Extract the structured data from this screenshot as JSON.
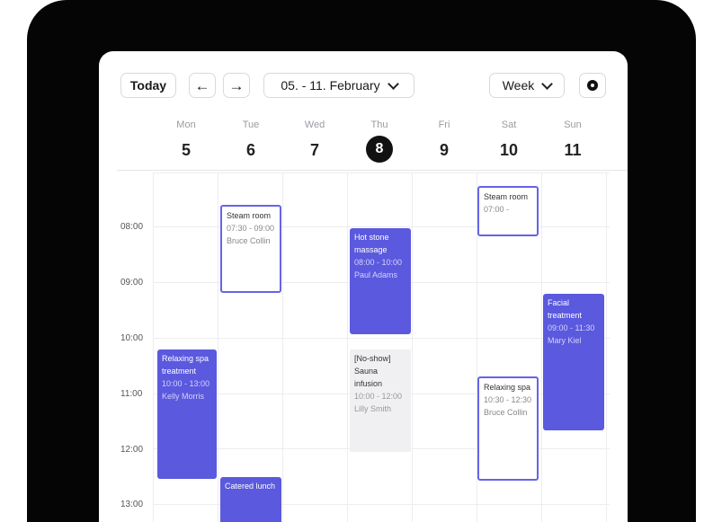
{
  "toolbar": {
    "today_label": "Today",
    "prev_icon": "arrow-left-icon",
    "next_icon": "arrow-right-icon",
    "date_range": "05. - 11. February",
    "view_mode": "Week",
    "settings_icon": "gear-icon"
  },
  "days": [
    {
      "name": "Mon",
      "date": "5",
      "today": false
    },
    {
      "name": "Tue",
      "date": "6",
      "today": false
    },
    {
      "name": "Wed",
      "date": "7",
      "today": false
    },
    {
      "name": "Thu",
      "date": "8",
      "today": true
    },
    {
      "name": "Fri",
      "date": "9",
      "today": false
    },
    {
      "name": "Sat",
      "date": "10",
      "today": false
    },
    {
      "name": "Sun",
      "date": "11",
      "today": false
    }
  ],
  "times": [
    "08:00",
    "09:00",
    "10:00",
    "11:00",
    "12:00",
    "13:00"
  ],
  "events": [
    {
      "title": "Steam room",
      "time": "07:30 - 09:00",
      "person": "Bruce Collin",
      "style": "outline"
    },
    {
      "title": "Steam room",
      "time": "07:00 -",
      "person": "",
      "style": "outline"
    },
    {
      "title": "Hot stone massage",
      "time": "08:00 - 10:00",
      "person": "Paul Adams",
      "style": "filled"
    },
    {
      "title": "Facial treatment",
      "time": "09:00 - 11:30",
      "person": "Mary Kiel",
      "style": "filled"
    },
    {
      "title": "Relaxing spa treatment",
      "time": "10:00 - 13:00",
      "person": "Kelly Morris",
      "style": "filled"
    },
    {
      "title": "[No-show] Sauna infusion",
      "time": "10:00 - 12:00",
      "person": "Lilly Smith",
      "style": "grey"
    },
    {
      "title": "Relaxing spa",
      "time": "10:30 - 12:30",
      "person": "Bruce Collin",
      "style": "outline"
    },
    {
      "title": "Catered lunch",
      "time": "",
      "person": "",
      "style": "filled"
    }
  ],
  "colors": {
    "accent": "#5b59de",
    "today_circle": "#111111",
    "device_frame": "#050505"
  }
}
